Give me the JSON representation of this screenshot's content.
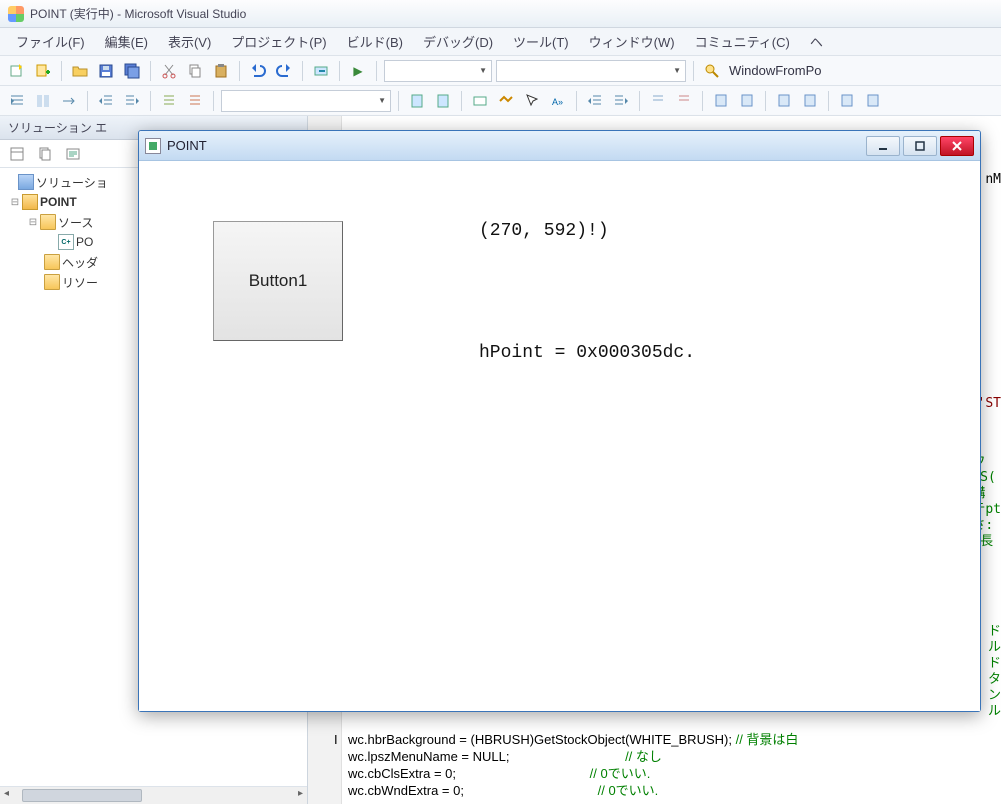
{
  "titlebar": {
    "text": "POINT (実行中) - Microsoft Visual Studio"
  },
  "menu": {
    "file": "ファイル(F)",
    "edit": "編集(E)",
    "view": "表示(V)",
    "project": "プロジェクト(P)",
    "build": "ビルド(B)",
    "debug": "デバッグ(D)",
    "tools": "ツール(T)",
    "window": "ウィンドウ(W)",
    "community": "コミュニティ(C)",
    "help": "ヘ"
  },
  "toolbar2_label": "WindowFromPo",
  "solution": {
    "header": "ソリューション エ",
    "root": "ソリューショ",
    "project": "POINT",
    "src": "ソース",
    "cpp": "PO",
    "hdr": "ヘッダ",
    "res": "リソー"
  },
  "appwin": {
    "title": "POINT",
    "button": "Button1",
    "coords": "(270, 592)!)",
    "hpoint": "hPoint = 0x000305dc."
  },
  "code": {
    "l1a": "wc.hbrBackground = (HBRUSH)GetStockObject(WHITE_BRUSH);",
    "l1b": " // 背景は白",
    "l2a": "wc.lpszMenuName = NULL;",
    "l2b": "                                // なし",
    "l3a": "wc.cbClsExtra = 0;",
    "l3b": "                                     // 0でいい.",
    "l4a": "wc.cbWndExtra = 0;",
    "l4b": "                                     // 0でいい."
  },
  "right": {
    "nm": "nM",
    "st": "'ST",
    "frag1": "ウ\nMS(\n構\nテpt\nさ:\n(長",
    "frag2": "ド\nル\nド\nタ\nン\nル"
  }
}
